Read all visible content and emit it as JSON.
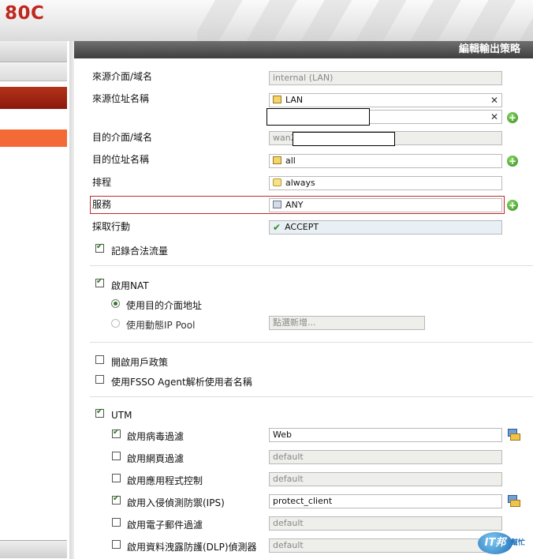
{
  "app": {
    "brand": "80C"
  },
  "header": {
    "title": "編輯輸出策略"
  },
  "form": {
    "src_intf_label": "來源介面/域名",
    "src_intf_value": "internal (LAN)",
    "src_addr_label": "來源位址名稱",
    "src_addr_value": "LAN",
    "dst_intf_label": "目的介面/域名",
    "dst_intf_value": "wan2",
    "dst_addr_label": "目的位址名稱",
    "dst_addr_value": "all",
    "schedule_label": "排程",
    "schedule_value": "always",
    "service_label": "服務",
    "service_value": "ANY",
    "action_label": "採取行動",
    "action_value": "ACCEPT",
    "log_traffic_label": "記錄合法流量",
    "nat_label": "啟用NAT",
    "nat_dst_label": "使用目的介面地址",
    "nat_pool_label": "使用動態IP Pool",
    "nat_pool_placeholder": "點選新增...",
    "identity_label": "開啟用戶政策",
    "fsso_label": "使用FSSO Agent解析使用者名稱",
    "utm_label": "UTM",
    "antivirus_label": "啟用病毒過濾",
    "antivirus_value": "Web",
    "webfilter_label": "啟用網頁過濾",
    "webfilter_value": "default",
    "appctrl_label": "啟用應用程式控制",
    "appctrl_value": "default",
    "ips_label": "啟用入侵偵測防禦(IPS)",
    "ips_value": "protect_client",
    "email_label": "啟用電子郵件過濾",
    "email_value": "default",
    "dlp_label": "啟用資料洩露防護(DLP)偵測器",
    "dlp_value": "default",
    "remove_glyph": "✕",
    "add_glyph": "+"
  },
  "checks": {
    "log_traffic": true,
    "nat": true,
    "identity": false,
    "fsso": false,
    "utm": true,
    "antivirus": true,
    "webfilter": false,
    "appctrl": false,
    "ips": true,
    "email": false,
    "dlp": false
  },
  "watermark": {
    "logo": "IT邦",
    "text": "幫忙"
  },
  "colors": {
    "brand": "#c0271e",
    "highlight_border": "#c02a2a",
    "accent_orange": "#f46a37"
  }
}
